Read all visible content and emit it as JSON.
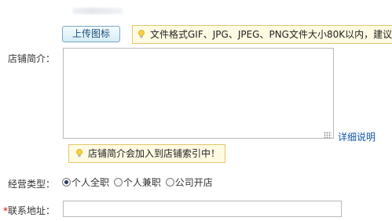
{
  "upload": {
    "button_label": "上传图标"
  },
  "format_tip": {
    "text": "文件格式GIF、JPG、JPEG、PNG文件大小80K以内，建议"
  },
  "intro": {
    "label": "店铺简介：",
    "value": "",
    "detail_link": "详细说明",
    "index_tip": "店铺简介会加入到店铺索引中！"
  },
  "business_type": {
    "label": "经营类型：",
    "options": [
      {
        "label": "个人全职",
        "checked": true
      },
      {
        "label": "个人兼职",
        "checked": false
      },
      {
        "label": "公司开店",
        "checked": false
      }
    ]
  },
  "contact_address": {
    "required_mark": "*",
    "label": "联系地址：",
    "value": ""
  },
  "colors": {
    "tip_border": "#e3c66c",
    "tip_background": "#fffbe3",
    "link": "#1155aa",
    "required": "#e00000"
  },
  "icons": {
    "tip": "lightbulb-icon",
    "resize": "resize-grip-icon"
  }
}
